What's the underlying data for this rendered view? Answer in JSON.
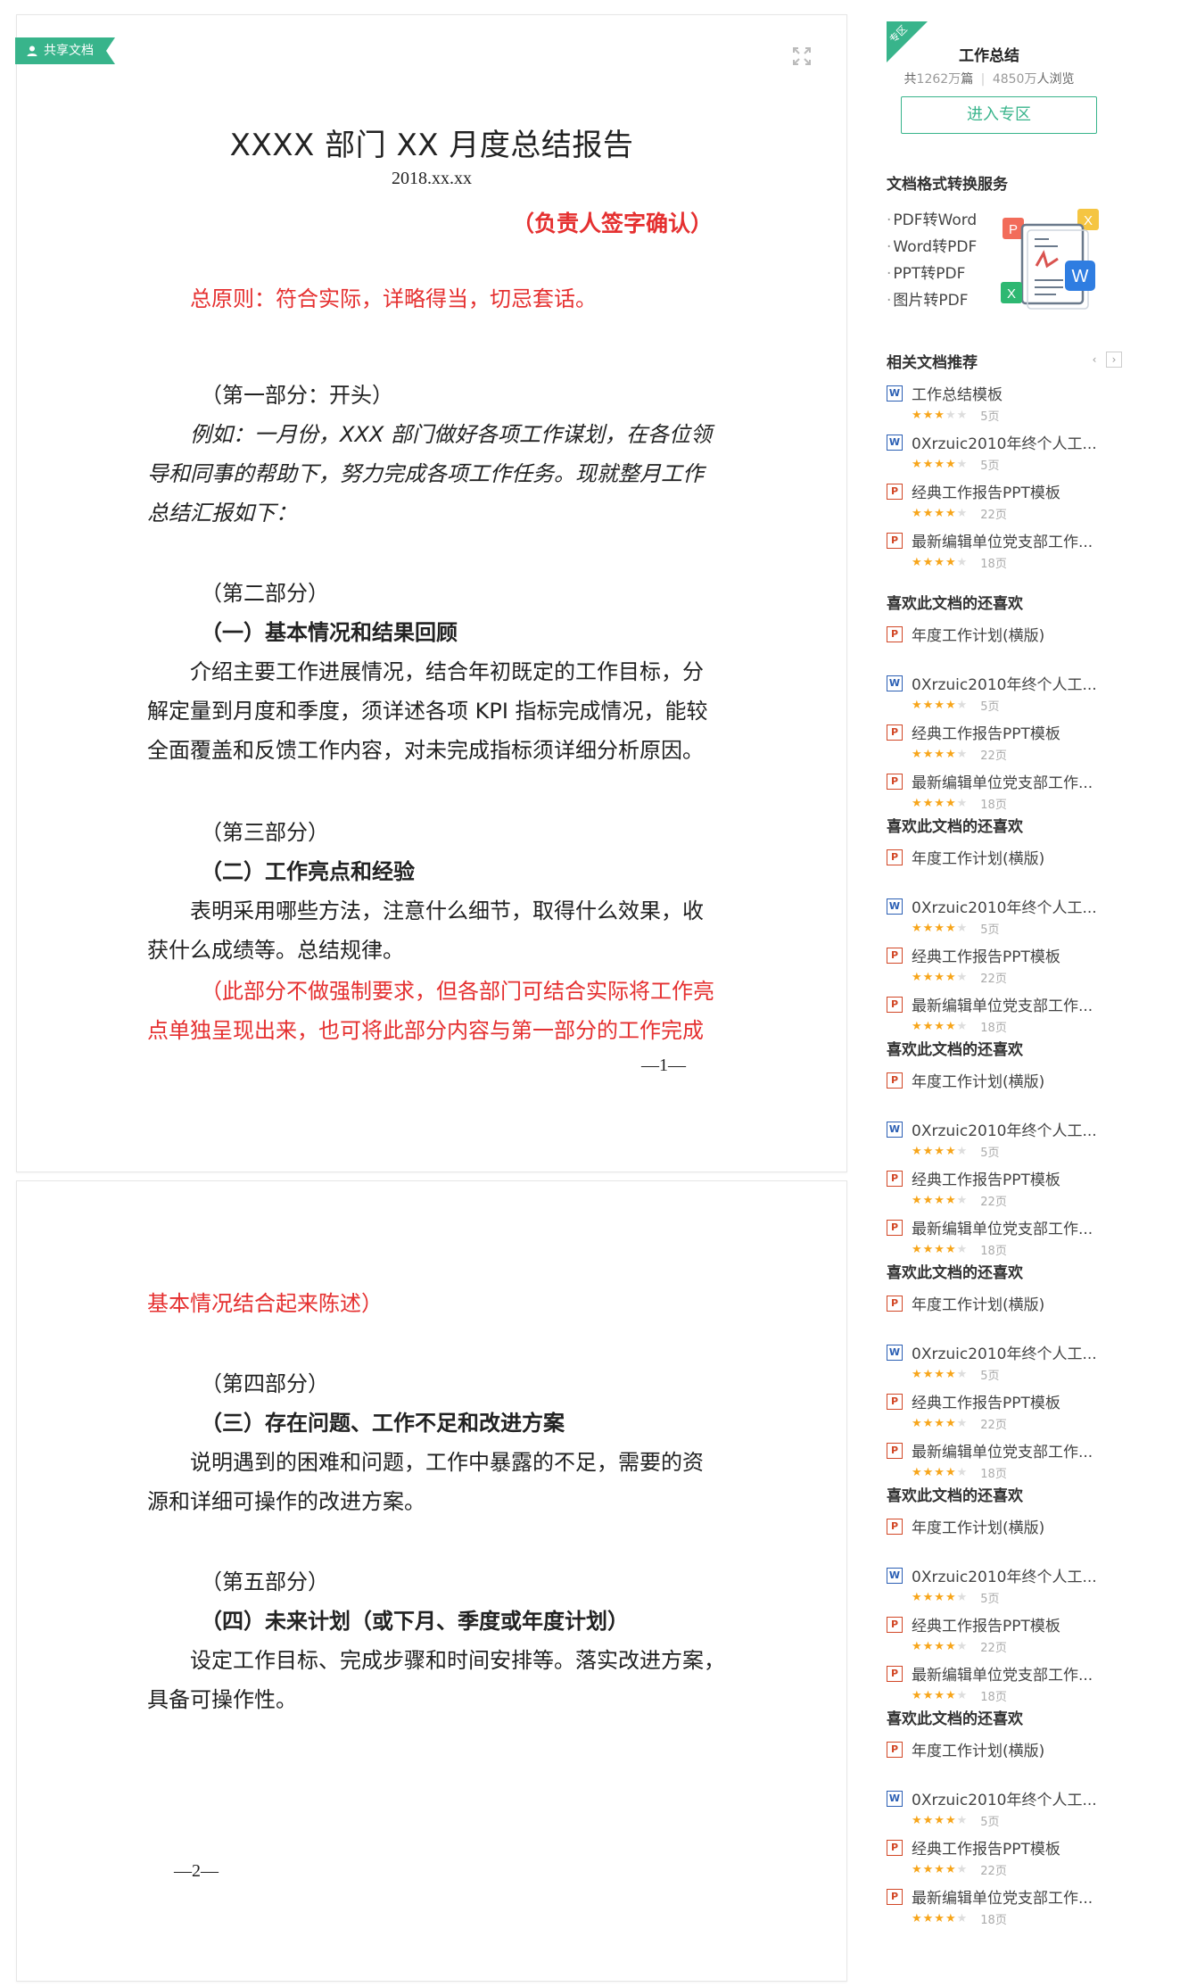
{
  "document": {
    "share_tag": "共享文档",
    "title": "XXXX 部门 XX 月度总结报告",
    "date": "2018.xx.xx",
    "sign_note": "（负责人签字确认）",
    "page1_lines": [
      "总原则：符合实际，详略得当，切忌套话。",
      "（第一部分：开头）",
      "例如：一月份，XXX 部门做好各项工作谋划，在各位领",
      "导和同事的帮助下，努力完成各项工作任务。现就整月工作",
      "总结汇报如下：",
      "（第二部分）",
      "（一）基本情况和结果回顾",
      "介绍主要工作进展情况，结合年初既定的工作目标，分",
      "解定量到月度和季度，须详述各项 KPI 指标完成情况，能较",
      "全面覆盖和反馈工作内容，对未完成指标须详细分析原因。",
      "（第三部分）",
      "（二）工作亮点和经验",
      "表明采用哪些方法，注意什么细节，取得什么效果，收",
      "获什么成绩等。总结规律。",
      "（此部分不做强制要求，但各部门可结合实际将工作亮",
      "点单独呈现出来，也可将此部分内容与第一部分的工作完成"
    ],
    "page1_num": "—1—",
    "page2_lines": [
      "基本情况结合起来陈述）",
      "（第四部分）",
      "（三）存在问题、工作不足和改进方案",
      "说明遇到的困难和问题，工作中暴露的不足，需要的资",
      "源和详细可操作的改进方案。",
      "（第五部分）",
      "（四）未来计划（或下月、季度或年度计划）",
      "设定工作目标、完成步骤和时间安排等。落实改进方案，",
      "具备可操作性。"
    ],
    "page2_num": "—2—"
  },
  "sidebar": {
    "topic": {
      "ribbon": "专区",
      "title": "工作总结",
      "stats_prefix": "共",
      "docs_count": "1262万",
      "docs_unit": "篇",
      "separator": "|",
      "views_count": "4850万",
      "views_unit": "人浏览",
      "button": "进入专区"
    },
    "conversion": {
      "title": "文档格式转换服务",
      "items": [
        "PDF转Word",
        "Word转PDF",
        "PPT转PDF",
        "图片转PDF"
      ]
    },
    "related_title": "相关文档推荐",
    "related": [
      {
        "type": "W",
        "title": "工作总结模板",
        "rating": 3,
        "half": false,
        "pages": "5页"
      },
      {
        "type": "W",
        "title": "0Xrzuic2010年终个人工...",
        "rating": 4,
        "half": false,
        "pages": "5页"
      },
      {
        "type": "P",
        "title": "经典工作报告PPT模板",
        "rating": 3,
        "half": true,
        "pages": "22页"
      },
      {
        "type": "P",
        "title": "最新编辑单位党支部工作...",
        "rating": 4,
        "half": false,
        "pages": "18页"
      }
    ],
    "like_title": "喜欢此文档的还喜欢",
    "liked": [
      {
        "type": "P",
        "title": "年度工作计划(横版)"
      },
      {
        "type": "W",
        "title": "0Xrzuic2010年终个人工...",
        "rating": 4,
        "half": false,
        "pages": "5页"
      },
      {
        "type": "P",
        "title": "经典工作报告PPT模板",
        "rating": 3,
        "half": true,
        "pages": "22页"
      },
      {
        "type": "P",
        "title": "最新编辑单位党支部工作...",
        "rating": 4,
        "half": false,
        "pages": "18页"
      }
    ],
    "colors": {
      "accent": "#38b48b",
      "red": "#e53030",
      "star": "#f7a51a"
    }
  }
}
